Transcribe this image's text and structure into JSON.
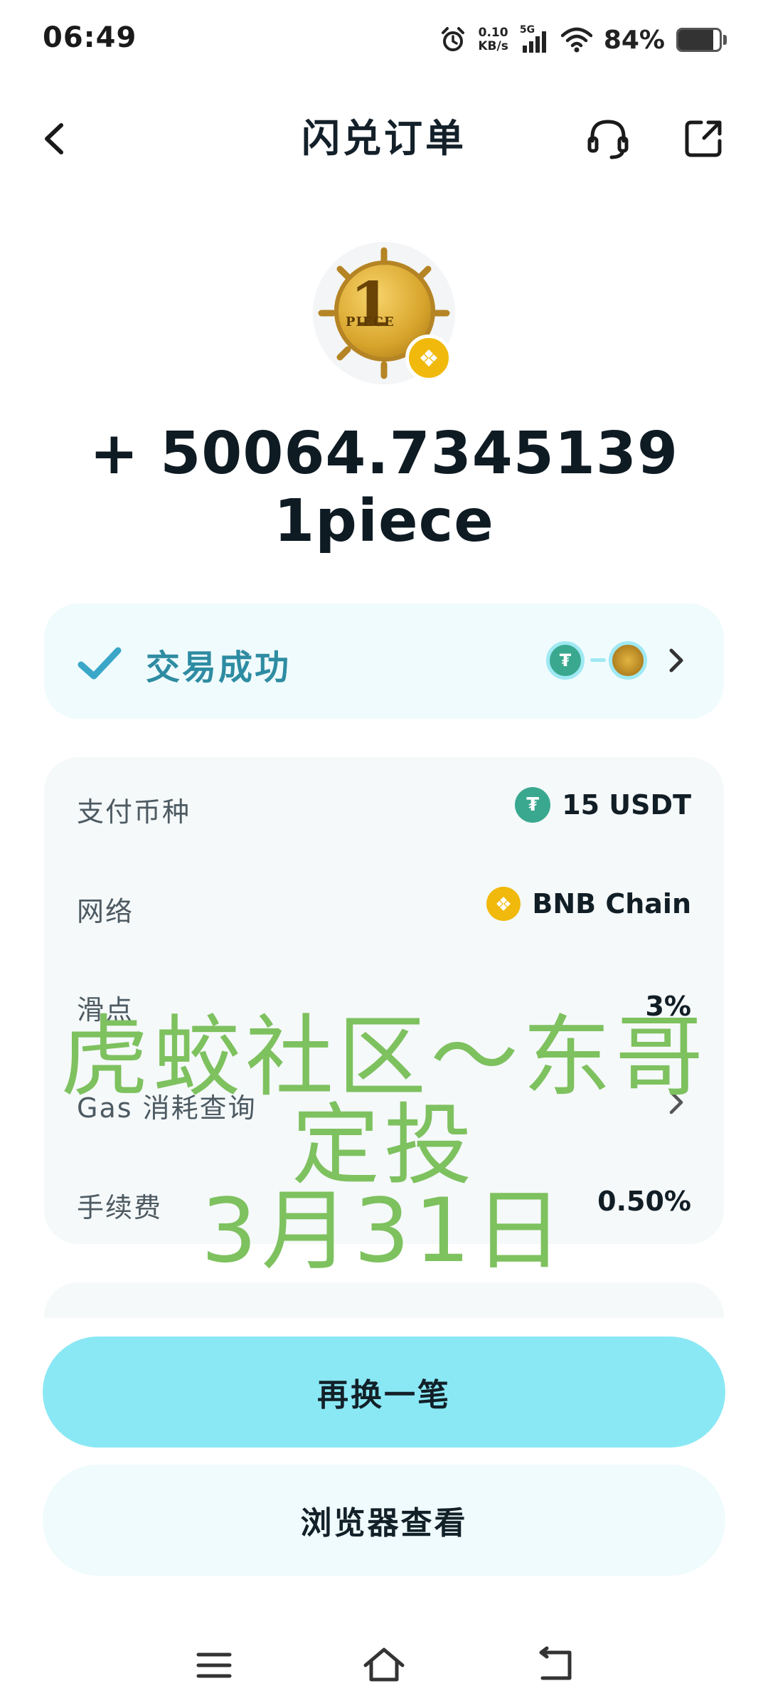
{
  "status_bar": {
    "time": "06:49",
    "net_speed_value": "0.10",
    "net_speed_unit": "KB/s",
    "network_type": "5G",
    "battery_percent": "84%",
    "battery_level": 0.84
  },
  "header": {
    "title": "闪兑订单",
    "icons": [
      "back-icon",
      "headset-icon",
      "share-icon"
    ]
  },
  "token": {
    "logo_text": "1",
    "logo_subtext": "PIECE",
    "amount": "+ 50064.7345139 1piece"
  },
  "status_card": {
    "label": "交易成功",
    "icons": [
      "check-icon",
      "usdt-route-icon",
      "piece-route-icon",
      "chevron-right-icon"
    ]
  },
  "details": {
    "pay_label": "支付币种",
    "pay_value": "15 USDT",
    "network_label": "网络",
    "network_value": "BNB Chain",
    "slippage_label": "滑点",
    "slippage_value": "3%",
    "gas_label": "Gas 消耗查询",
    "fee_label": "手续费",
    "fee_value": "0.50%"
  },
  "watermark": {
    "line1": "虎蛟社区～东哥",
    "line2": "定投",
    "line3": "3月31日"
  },
  "buttons": {
    "primary": "再换一笔",
    "secondary": "浏览器查看"
  },
  "colors": {
    "accent": "#8ae8f4",
    "success_text": "#2e8ca2",
    "watermark": "#7ec15f",
    "usdt": "#3aa88f",
    "bnb": "#f0b90b"
  }
}
